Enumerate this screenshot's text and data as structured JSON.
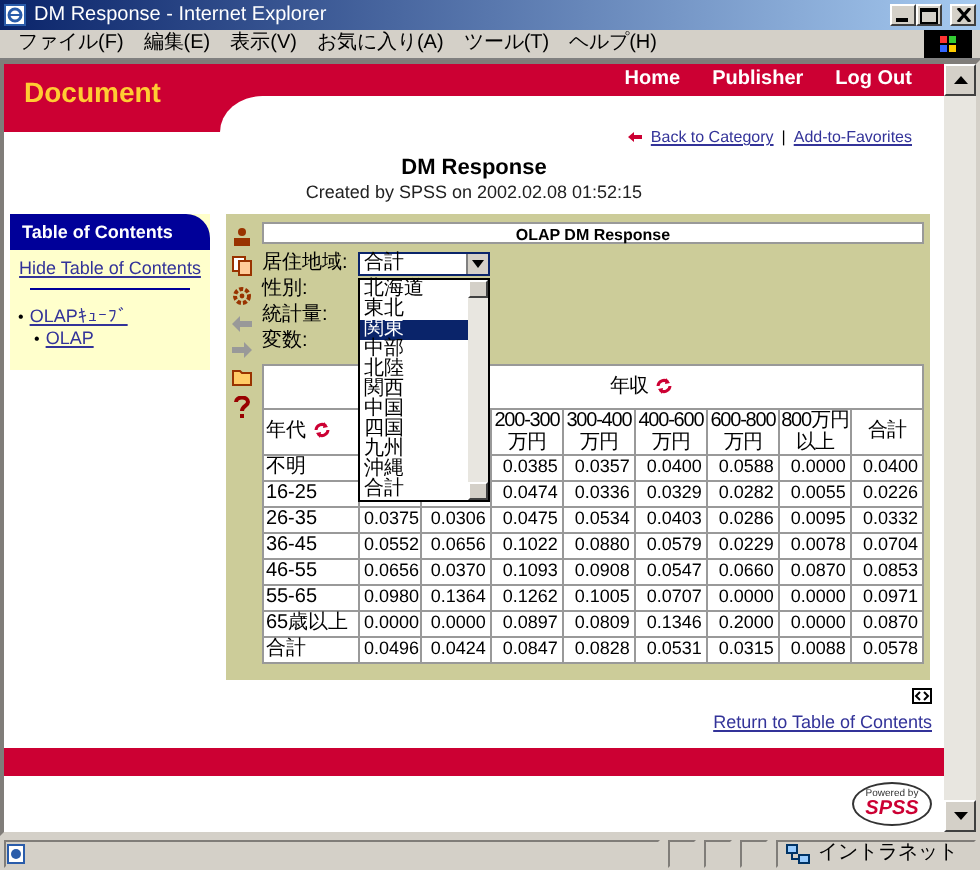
{
  "window": {
    "title": "DM Response - Internet Explorer"
  },
  "menu": [
    "ファイル(F)",
    "編集(E)",
    "表示(V)",
    "お気に入り(A)",
    "ツール(T)",
    "ヘルプ(H)"
  ],
  "header": {
    "brand": "Document",
    "nav": [
      "Home",
      "Publisher",
      "Log Out"
    ]
  },
  "page_links": {
    "items": [
      "Back to Category",
      "Add-to-Favorites"
    ],
    "separator": "|"
  },
  "title": "DM Response",
  "subtitle": "Created by SPSS on 2002.02.08 01:52:15",
  "toc": {
    "title": "Table of Contents",
    "hide_link": "Hide Table of Contents",
    "items": [
      {
        "marker": "•",
        "label": "OLAPｷｭｰﾌﾞ",
        "children": [
          {
            "marker": "•",
            "label": "OLAP"
          }
        ]
      }
    ]
  },
  "olap": {
    "title": "OLAP DM Response",
    "filters": [
      {
        "label": "居住地域:",
        "kind": "select",
        "value": "合計",
        "expanded": true
      },
      {
        "label": "性別:",
        "kind": "text"
      },
      {
        "label": "統計量:",
        "kind": "text"
      },
      {
        "label": "変数:",
        "kind": "text"
      }
    ],
    "dropdown_options": [
      {
        "label": "北海道",
        "selected": false
      },
      {
        "label": "東北",
        "selected": false
      },
      {
        "label": "関東",
        "selected": true
      },
      {
        "label": "中部",
        "selected": false
      },
      {
        "label": "北陸",
        "selected": false
      },
      {
        "label": "関西",
        "selected": false
      },
      {
        "label": "中国",
        "selected": false
      },
      {
        "label": "四国",
        "selected": false
      },
      {
        "label": "九州",
        "selected": false
      },
      {
        "label": "沖縄",
        "selected": false
      },
      {
        "label": "合計",
        "selected": false
      }
    ],
    "table": {
      "column_group": "年収",
      "row_header": "年代",
      "columns": [
        "200-300万円",
        "300-400万円",
        "400-600万円",
        "600-800万円",
        "800万円以上",
        "合計"
      ],
      "rows": [
        {
          "label": "不明",
          "values": [
            "0.0385",
            "0.0357",
            "0.0400",
            "0.0588",
            "0.0000",
            "0.0400"
          ]
        },
        {
          "label": "16-25",
          "values": [
            "0.0474",
            "0.0336",
            "0.0329",
            "0.0282",
            "0.0055",
            "0.0226"
          ]
        },
        {
          "label": "26-35",
          "values": [
            "0.0375",
            "0.0306",
            "0.0475",
            "0.0534",
            "0.0403",
            "0.0286",
            "0.0095",
            "0.0332"
          ]
        },
        {
          "label": "36-45",
          "values": [
            "0.0552",
            "0.0656",
            "0.1022",
            "0.0880",
            "0.0579",
            "0.0229",
            "0.0078",
            "0.0704"
          ]
        },
        {
          "label": "46-55",
          "values": [
            "0.0656",
            "0.0370",
            "0.1093",
            "0.0908",
            "0.0547",
            "0.0660",
            "0.0870",
            "0.0853"
          ]
        },
        {
          "label": "55-65",
          "values": [
            "0.0980",
            "0.1364",
            "0.1262",
            "0.1005",
            "0.0707",
            "0.0000",
            "0.0000",
            "0.0971"
          ]
        },
        {
          "label": "65歳以上",
          "values": [
            "0.0000",
            "0.0000",
            "0.0897",
            "0.0809",
            "0.1346",
            "0.2000",
            "0.0000",
            "0.0870"
          ]
        },
        {
          "label": "合計",
          "values": [
            "0.0496",
            "0.0424",
            "0.0847",
            "0.0828",
            "0.0531",
            "0.0315",
            "0.0088",
            "0.0578"
          ]
        }
      ]
    }
  },
  "return_link": "Return to Table of Contents",
  "logo": {
    "small": "Powered by",
    "name": "SPSS"
  },
  "status_bar": {
    "zone": "イントラネット"
  }
}
